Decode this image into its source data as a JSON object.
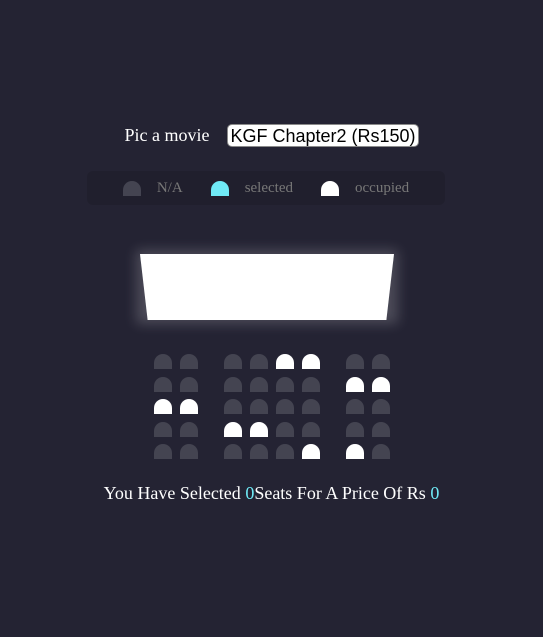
{
  "movie_picker": {
    "label": "Pic a movie",
    "selected_value": "KGF Chapter2 (Rs150)"
  },
  "legend": {
    "items": [
      {
        "label": "N/A",
        "state": "available"
      },
      {
        "label": "selected",
        "state": "selected"
      },
      {
        "label": "occupied",
        "state": "occupied"
      }
    ]
  },
  "colors": {
    "background": "#242333",
    "seat_available": "#444451",
    "seat_selected": "#6feaf6",
    "seat_occupied": "#ffffff"
  },
  "seat_rows": [
    [
      "available",
      "available",
      "available",
      "available",
      "occupied",
      "occupied",
      "available",
      "available"
    ],
    [
      "available",
      "available",
      "available",
      "available",
      "available",
      "available",
      "occupied",
      "occupied"
    ],
    [
      "occupied",
      "occupied",
      "available",
      "available",
      "available",
      "available",
      "available",
      "available"
    ],
    [
      "available",
      "available",
      "occupied",
      "occupied",
      "available",
      "available",
      "available",
      "available"
    ],
    [
      "available",
      "available",
      "available",
      "available",
      "available",
      "occupied",
      "occupied",
      "available"
    ]
  ],
  "summary": {
    "prefix": "You Have Selected ",
    "seat_count": "0",
    "middle": "Seats For A Price Of Rs ",
    "total_price": "0"
  }
}
